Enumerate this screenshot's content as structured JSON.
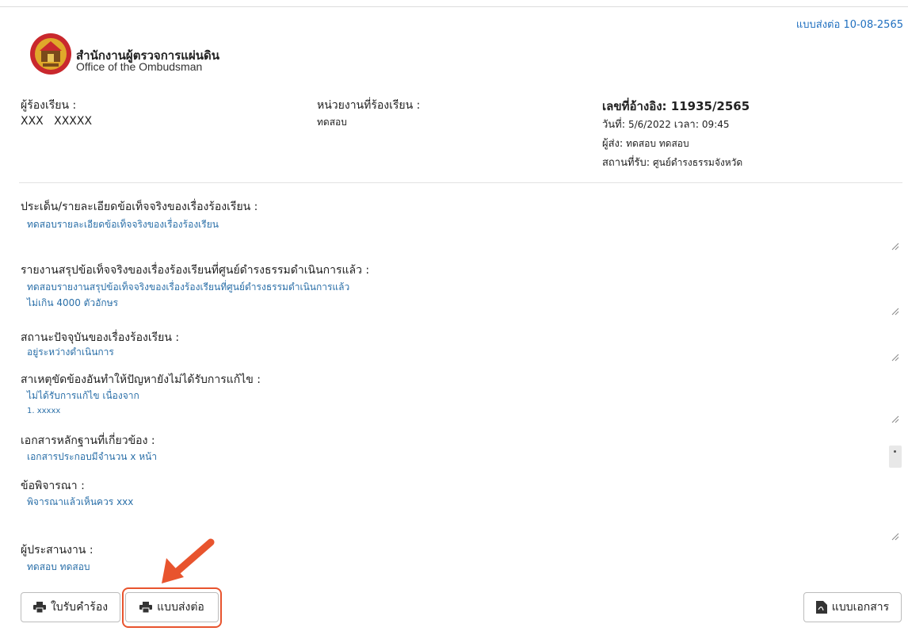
{
  "header": {
    "form_ref": "แบบส่งต่อ 10-08-2565",
    "org_name_th": "สำนักงานผู้ตรวจการแผ่นดิน",
    "org_name_en": "Office of the Ombudsman"
  },
  "info": {
    "complainant_label": "ผู้ร้องเรียน :",
    "complainant_value": "XXX   XXXXX",
    "agency_label": "หน่วยงานที่ร้องเรียน :",
    "agency_value": "ทดสอบ",
    "ref_no": "เลขที่อ้างอิง: 11935/2565",
    "date_label": "วันที่:",
    "date_value": "5/6/2022",
    "time_label": "เวลา:",
    "time_value": "09:45",
    "sender_label": "ผู้ส่ง:",
    "sender_value": "ทดสอบ ทดสอบ",
    "place_label": "สถานที่รับ:",
    "place_value": "ศูนย์ดำรงธรรมจังหวัด"
  },
  "sections": {
    "issue_title": "ประเด็น/รายละเอียดข้อเท็จจริงของเรื่องร้องเรียน :",
    "issue_text": "ทดสอบรายละเอียดข้อเท็จจริงของเรื่องร้องเรียน",
    "report_title": "รายงานสรุปข้อเท็จจริงของเรื่องร้องเรียนที่ศูนย์ดำรงธรรมดำเนินการแล้ว :",
    "report_text_1": "ทดสอบรายงานสรุปข้อเท็จจริงของเรื่องร้องเรียนที่ศูนย์ดำรงธรรมดำเนินการแล้ว",
    "report_text_2": "ไม่เกิน 4000 ตัวอักษร",
    "status_title": "สถานะปัจจุบันของเรื่องร้องเรียน :",
    "status_text": "อยู่ระหว่างดำเนินการ",
    "cause_title": "สาเหตุขัดข้องอันทำให้ปัญหายังไม่ได้รับการแก้ไข :",
    "cause_text_1": "ไม่ได้รับการแก้ไข เนื่องจาก",
    "cause_text_2": "1. xxxxx",
    "docs_title": "เอกสารหลักฐานที่เกี่ยวข้อง :",
    "docs_text": "เอกสารประกอบมีจำนวน x หน้า",
    "consider_title": "ข้อพิจารณา :",
    "consider_text": "พิจารณาแล้วเห็นควร xxx",
    "coord_title": "ผู้ประสานงาน :",
    "coord_text": "ทดสอบ ทดสอบ"
  },
  "buttons": {
    "receipt_label": "ใบรับคำร้อง",
    "forward_label": "แบบส่งต่อ",
    "document_label": "แบบเอกสาร"
  },
  "colors": {
    "link_text": "#2a6fa8",
    "highlight": "#e8542e"
  }
}
